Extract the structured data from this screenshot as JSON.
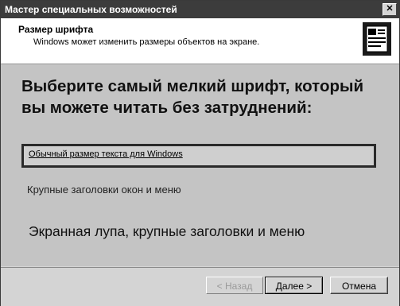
{
  "window": {
    "title": "Мастер специальных возможностей",
    "close_label": "✕"
  },
  "header": {
    "title": "Размер шрифта",
    "subtitle": "Windows может изменить размеры объектов на экране.",
    "icon": "wizard-page-icon"
  },
  "content": {
    "heading": "Выберите самый мелкий шрифт, который вы можете читать без затруднений:",
    "options": [
      {
        "label": "Обычный размер текста для Windows",
        "selected": true
      },
      {
        "label": "Крупные заголовки окон и меню",
        "selected": false
      },
      {
        "label": "Экранная лупа, крупные заголовки и меню",
        "selected": false
      }
    ]
  },
  "footer": {
    "back_label": "< Назад",
    "next_label": "Далее >",
    "cancel_label": "Отмена"
  }
}
